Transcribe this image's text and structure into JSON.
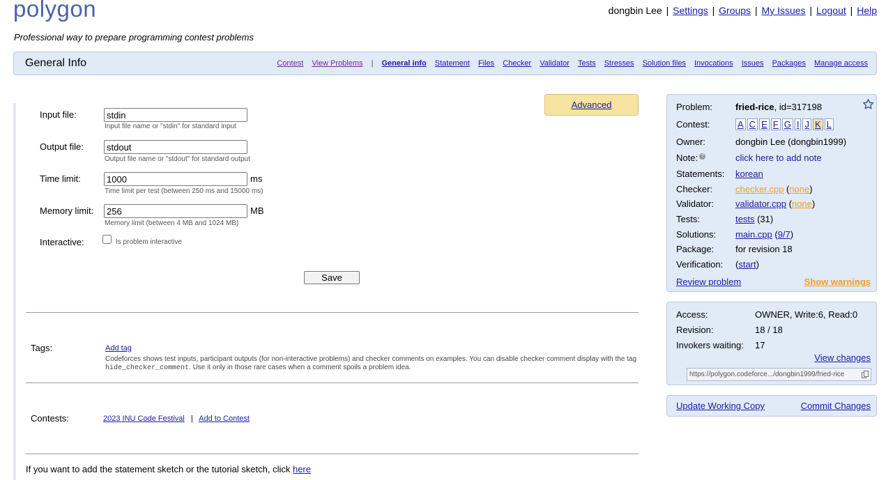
{
  "header": {
    "logo": "polygon",
    "tagline": "Professional way to prepare programming contest problems",
    "user": "dongbin Lee",
    "links": [
      "Settings",
      "Groups",
      "My Issues",
      "Logout",
      "Help"
    ]
  },
  "menubar": {
    "title": "General Info",
    "tabs_left": [
      "Contest",
      "View Problems"
    ],
    "separator": "|",
    "tabs_right": [
      "General info",
      "Statement",
      "Files",
      "Checker",
      "Validator",
      "Tests",
      "Stresses",
      "Solution files",
      "Invocations",
      "Issues",
      "Packages",
      "Manage access"
    ]
  },
  "form": {
    "advanced_label": "Advanced",
    "input_file": {
      "label": "Input file:",
      "value": "stdin",
      "hint": "Input file name or \"stdin\" for standard input"
    },
    "output_file": {
      "label": "Output file:",
      "value": "stdout",
      "hint": "Output file name or \"stdout\" for standard output"
    },
    "time_limit": {
      "label": "Time limit:",
      "value": "1000",
      "unit": "ms",
      "hint": "Time limit per test (between 250 ms and 15000 ms)"
    },
    "memory_limit": {
      "label": "Memory limit:",
      "value": "256",
      "unit": "MB",
      "hint": "Memory limit (between 4 MB and 1024 MB)"
    },
    "interactive": {
      "label": "Interactive:",
      "checkbox_label": "Is problem interactive"
    },
    "save_label": "Save"
  },
  "tags": {
    "label": "Tags:",
    "add_label": "Add tag",
    "desc_1": "Codeforces shows test inputs, participant outputs (for non-interactive problems) and checker comments on examples. You can disable checker comment display with the tag ",
    "desc_code": "hide_checker_comment",
    "desc_2": ". Use it only in those rare cases when a comment spoils a problem idea."
  },
  "contests": {
    "label": "Contests:",
    "contest_link": "2023 INU Code Festival",
    "separator": "|",
    "add_link": "Add to Contest"
  },
  "footer_note": {
    "text": "If you want to add the statement sketch or the tutorial sketch, click ",
    "link": "here"
  },
  "problem_panel": {
    "problem_label": "Problem:",
    "problem_name": "fried-rice",
    "problem_id": ", id=317198",
    "contest_label": "Contest:",
    "contest_letters": [
      "A",
      "C",
      "E",
      "F",
      "G",
      "I",
      "J",
      "K",
      "L"
    ],
    "highlighted_letter": "K",
    "owner_label": "Owner:",
    "owner_value": "dongbin Lee (dongbin1999)",
    "note_label": "Note:",
    "note_help": "?",
    "note_link": "click here to add note",
    "statements_label": "Statements:",
    "statements_link": "korean",
    "checker_label": "Checker:",
    "checker_link": "checker.cpp",
    "checker_none": "none",
    "validator_label": "Validator:",
    "validator_link": "validator.cpp",
    "validator_none": "none",
    "tests_label": "Tests:",
    "tests_link": "tests",
    "tests_count": " (31)",
    "solutions_label": "Solutions:",
    "solutions_link": "main.cpp",
    "solutions_ratio": "9/7",
    "package_label": "Package:",
    "package_value": "for revision 18",
    "verification_label": "Verification:",
    "verification_link": "start",
    "review_link": "Review problem",
    "warnings_link": "Show warnings"
  },
  "access_panel": {
    "access_label": "Access:",
    "access_value": "OWNER, Write:6, Read:0",
    "revision_label": "Revision:",
    "revision_value": "18 / 18",
    "invokers_label": "Invokers waiting:",
    "invokers_value": "17",
    "view_changes": "View changes",
    "url": "https://polygon.codeforce.../dongbin1999/fried-rice"
  },
  "actions_panel": {
    "update_link": "Update Working Copy",
    "commit_link": "Commit Changes"
  },
  "colors": {
    "panel_bg": "#e1eaf7",
    "panel_border": "#b9c8e4",
    "link": "#1a1aa6",
    "warning": "#f0a020",
    "advanced_bg": "#f7e3a0",
    "logo": "#4a63a8"
  }
}
